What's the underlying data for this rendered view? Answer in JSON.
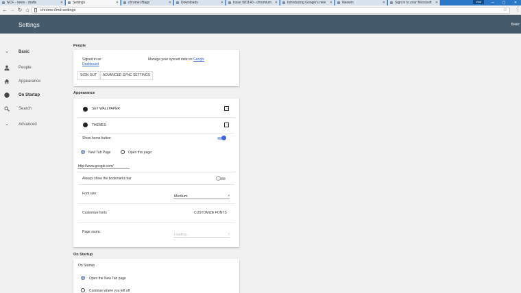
{
  "browser": {
    "tabs": [
      {
        "label": "NCF - news - drafts",
        "active": false
      },
      {
        "label": "Settings",
        "active": true
      },
      {
        "label": "chrome://flags",
        "active": false
      },
      {
        "label": "Downloads",
        "active": false
      },
      {
        "label": "Issue 581140 - chromium",
        "active": false
      },
      {
        "label": "Introducing Google's new",
        "active": false
      },
      {
        "label": "Neowin",
        "active": false
      },
      {
        "label": "Sign in to your Microsoft",
        "active": false
      }
    ],
    "user_badge": "Vlad",
    "window_minimize": "–",
    "window_maximize": "▢",
    "window_close": "✕",
    "url": "chrome://md-settings",
    "colors": {
      "tab_strip": "#2b78c9",
      "header": "#455b6c",
      "accent": "#3f65d6"
    }
  },
  "header": {
    "title": "Settings",
    "mode": "Basic"
  },
  "sidebar": {
    "items": [
      {
        "label": "Basic",
        "icon": "chevron-down-icon"
      },
      {
        "label": "People",
        "icon": "person-icon"
      },
      {
        "label": "Appearance",
        "icon": "home-icon"
      },
      {
        "label": "On Startup",
        "icon": "power-icon"
      },
      {
        "label": "Search",
        "icon": "search-icon"
      },
      {
        "label": "Advanced",
        "icon": "chevron-down-icon"
      }
    ]
  },
  "people": {
    "heading": "People",
    "signed_in_line1": "Signed in as",
    "signed_in_link": "Dashboard",
    "manage_text": "Manage your synced data on",
    "manage_link": "Google",
    "sign_out": "SIGN OUT",
    "advanced_sync": "ADVANCED SYNC SETTINGS"
  },
  "appearance": {
    "heading": "Appearance",
    "set_wallpaper": "SET WALLPAPER",
    "themes": "THEMES",
    "show_home_button": "Show home button",
    "show_home_button_on": true,
    "radio_new_tab": "New Tab Page",
    "radio_open_page": "Open this page:",
    "home_url": "http://www.google.com/",
    "show_bookmarks_bar": "Always show the bookmarks bar",
    "show_bookmarks_bar_on": false,
    "font_size_label": "Font size:",
    "font_size_value": "Medium",
    "customize_fonts_label": "Customize fonts",
    "customize_fonts_button": "CUSTOMIZE FONTS",
    "page_zoom_label": "Page zoom:",
    "page_zoom_value": "Loading..."
  },
  "startup": {
    "heading": "On Startup",
    "card_title": "On Startup",
    "option_new_tab": "Open the New Tab page",
    "option_continue": "Continue where you left off"
  }
}
